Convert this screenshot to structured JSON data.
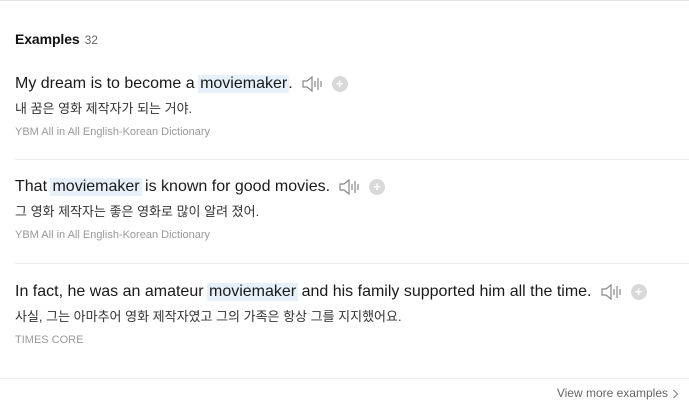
{
  "section": {
    "title": "Examples",
    "count": "32"
  },
  "examples": [
    {
      "pre": "My dream is to become a ",
      "highlight": "moviemaker",
      "post": ".",
      "ko": "내 꿈은 영화 제작자가 되는 거야.",
      "source": "YBM All in All English-Korean Dictionary"
    },
    {
      "pre": "That ",
      "highlight": "moviemaker",
      "post": " is known for good movies.",
      "ko": "그 영화 제작자는 좋은 영화로 많이 알려 졌어.",
      "source": "YBM All in All English-Korean Dictionary"
    },
    {
      "pre": "In fact, he was an amateur ",
      "highlight": "moviemaker",
      "post": " and his family supported him all the time.",
      "ko": "사실, 그는 아마추어 영화 제작자였고 그의 가족은 항상 그를 지지했어요.",
      "source": "TIMES CORE"
    }
  ],
  "footer": {
    "view_more_label": "View more examples"
  },
  "icons": {
    "sound": "speaker-icon",
    "add": "plus-icon",
    "more": "chevron-right-icon"
  },
  "colors": {
    "highlight": "#e6f1fb",
    "source": "#999999"
  }
}
